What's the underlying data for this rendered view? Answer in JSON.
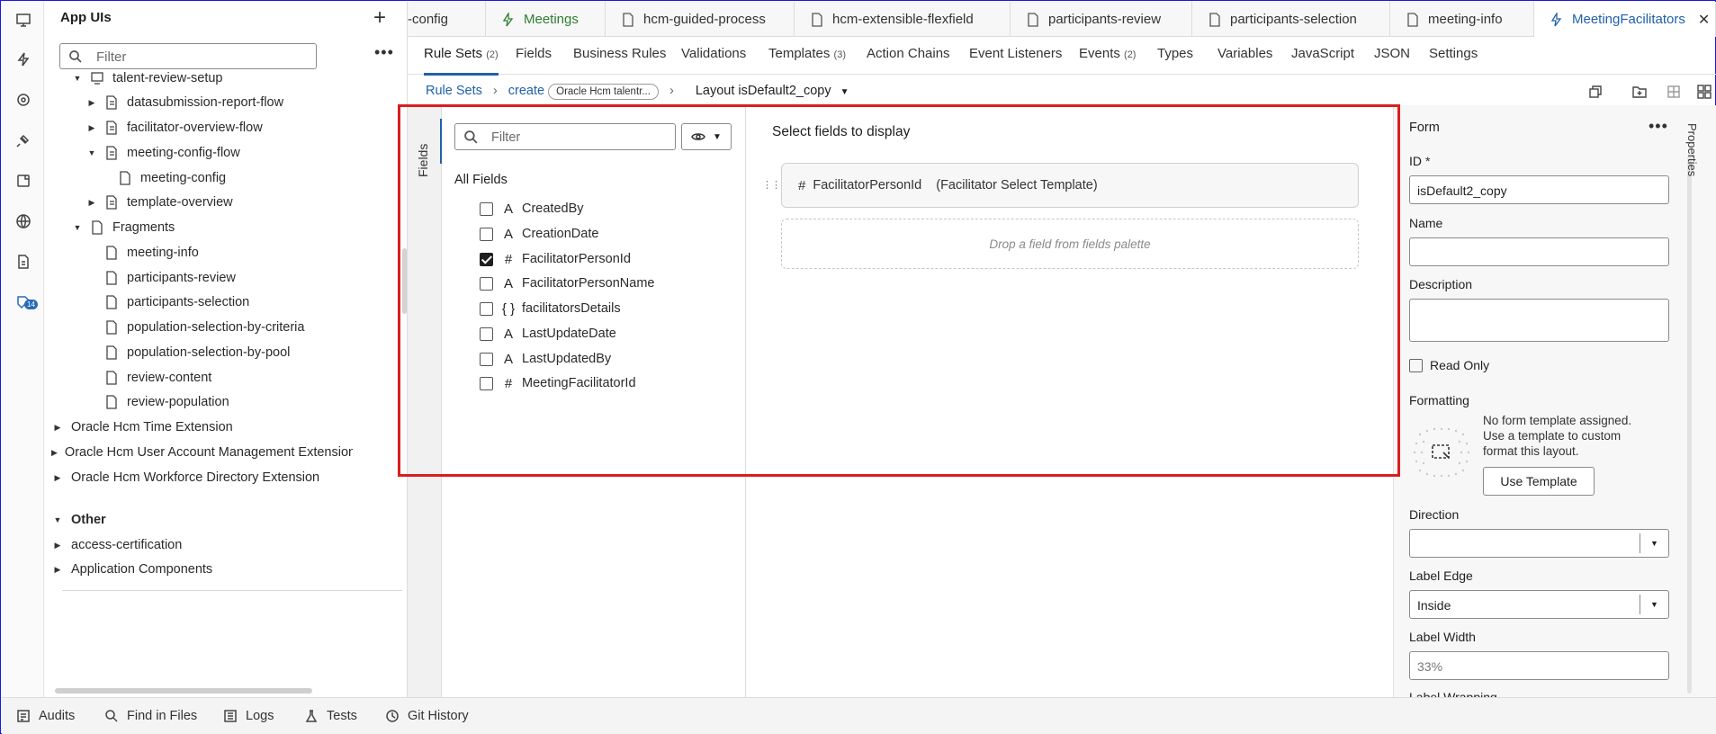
{
  "sidebar": {
    "title": "App UIs",
    "filter_placeholder": "Filter",
    "tree": [
      {
        "label": "talent-review-setup",
        "icon": "monitor-icon",
        "expanded": true
      },
      {
        "label": "datasubmission-report-flow",
        "icon": "flow-icon"
      },
      {
        "label": "facilitator-overview-flow",
        "icon": "flow-icon"
      },
      {
        "label": "meeting-config-flow",
        "icon": "flow-icon",
        "expanded": true
      },
      {
        "label": "meeting-config",
        "icon": "page-icon"
      },
      {
        "label": "template-overview",
        "icon": "flow-icon"
      },
      {
        "label": "Fragments",
        "icon": "page-icon",
        "expanded": true
      },
      {
        "label": "meeting-info",
        "icon": "page-icon"
      },
      {
        "label": "participants-review",
        "icon": "page-icon"
      },
      {
        "label": "participants-selection",
        "icon": "page-icon"
      },
      {
        "label": "population-selection-by-criteria",
        "icon": "page-icon"
      },
      {
        "label": "population-selection-by-pool",
        "icon": "page-icon"
      },
      {
        "label": "review-content",
        "icon": "page-icon"
      },
      {
        "label": "review-population",
        "icon": "page-icon"
      },
      {
        "label": "Oracle Hcm Time Extension"
      },
      {
        "label": "Oracle Hcm User Account Management Extension"
      },
      {
        "label": "Oracle Hcm Workforce Directory Extension"
      },
      {
        "label": "Other"
      },
      {
        "label": "access-certification"
      },
      {
        "label": "Application Components"
      }
    ]
  },
  "activity_badge": "14",
  "tabs": [
    {
      "label": "-config",
      "icon": ""
    },
    {
      "label": "Meetings",
      "icon": "action-chain-icon"
    },
    {
      "label": "hcm-guided-process",
      "icon": "page-icon"
    },
    {
      "label": "hcm-extensible-flexfield",
      "icon": "page-icon"
    },
    {
      "label": "participants-review",
      "icon": "page-icon"
    },
    {
      "label": "participants-selection",
      "icon": "page-icon"
    },
    {
      "label": "meeting-info",
      "icon": "page-icon"
    },
    {
      "label": "MeetingFacilitators",
      "icon": "business-object-icon",
      "active": true
    }
  ],
  "subtabs": [
    {
      "label": "Rule Sets",
      "count": "(2)"
    },
    {
      "label": "Fields",
      "count": ""
    },
    {
      "label": "Business Rules",
      "count": ""
    },
    {
      "label": "Validations",
      "count": ""
    },
    {
      "label": "Templates",
      "count": "(3)"
    },
    {
      "label": "Action Chains",
      "count": ""
    },
    {
      "label": "Event Listeners",
      "count": ""
    },
    {
      "label": "Events",
      "count": "(2)"
    },
    {
      "label": "Types",
      "count": ""
    },
    {
      "label": "Variables",
      "count": ""
    },
    {
      "label": "JavaScript",
      "count": ""
    },
    {
      "label": "JSON",
      "count": ""
    },
    {
      "label": "Settings",
      "count": ""
    }
  ],
  "breadcrumb": {
    "rule_sets": "Rule Sets",
    "create": "create",
    "chip": "Oracle Hcm talentr...",
    "layout": "Layout isDefault2_copy"
  },
  "palette": {
    "vertical_tab": "Fields",
    "filter_placeholder": "Filter",
    "all_fields": "All Fields",
    "fields": [
      {
        "name": "CreatedBy",
        "type": "A",
        "checked": false
      },
      {
        "name": "CreationDate",
        "type": "A",
        "checked": false
      },
      {
        "name": "FacilitatorPersonId",
        "type": "#",
        "checked": true
      },
      {
        "name": "FacilitatorPersonName",
        "type": "A",
        "checked": false
      },
      {
        "name": "facilitatorsDetails",
        "type": "{ }",
        "checked": false
      },
      {
        "name": "LastUpdateDate",
        "type": "A",
        "checked": false
      },
      {
        "name": "LastUpdatedBy",
        "type": "A",
        "checked": false
      },
      {
        "name": "MeetingFacilitatorId",
        "type": "#",
        "checked": false
      }
    ]
  },
  "designer": {
    "title": "Select fields to display",
    "field_name": "FacilitatorPersonId",
    "field_template": "(Facilitator Select Template)",
    "drop_hint": "Drop a field from fields palette"
  },
  "properties": {
    "vertical_tab": "Properties",
    "title": "Form",
    "id_label": "ID",
    "id_required": "*",
    "id_value": "isDefault2_copy",
    "name_label": "Name",
    "name_value": "",
    "description_label": "Description",
    "read_only_label": "Read Only",
    "formatting_label": "Formatting",
    "formatting_text": "No form template assigned. Use a template to custom format this layout.",
    "use_template_label": "Use Template",
    "direction_label": "Direction",
    "direction_value": "",
    "label_edge_label": "Label Edge",
    "label_edge_value": "Inside",
    "label_width_label": "Label Width",
    "label_width_placeholder": "33%",
    "label_wrapping_label": "Label Wrapping"
  },
  "footer": [
    {
      "label": "Audits",
      "icon": "audits-icon"
    },
    {
      "label": "Find in Files",
      "icon": "search-icon"
    },
    {
      "label": "Logs",
      "icon": "logs-icon"
    },
    {
      "label": "Tests",
      "icon": "tests-icon"
    },
    {
      "label": "Git History",
      "icon": "history-icon"
    }
  ],
  "colors": {
    "accent": "#2161a8",
    "highlight_box": "#db1d1d"
  }
}
